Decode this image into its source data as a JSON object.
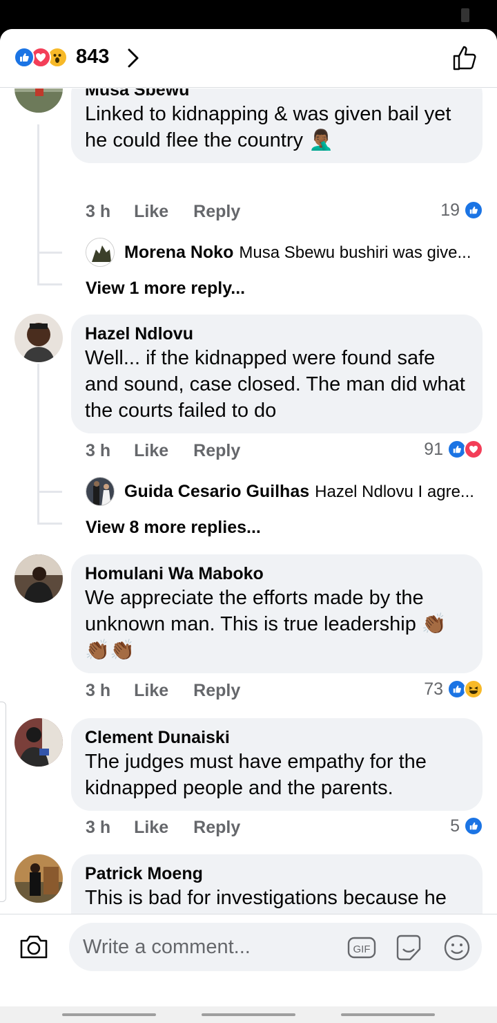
{
  "header": {
    "reaction_count": "843",
    "reaction_icons": [
      "like-icon",
      "love-icon",
      "wow-icon"
    ]
  },
  "comments": [
    {
      "name": "Musa Sbewu",
      "text": "Linked to kidnapping & was given bail yet he could flee the country 🤦🏾‍♂️",
      "time": "3 h",
      "like_label": "Like",
      "reply_label": "Reply",
      "reaction_count": "19",
      "reactions": [
        "like"
      ],
      "reply_preview": {
        "name": "Morena Noko",
        "text": "Musa Sbewu bushiri was give..."
      },
      "more_replies": "View 1 more reply..."
    },
    {
      "name": "Hazel Ndlovu",
      "text": "Well... if the kidnapped were found safe and sound, case closed. The man did what the courts failed to do",
      "time": "3 h",
      "like_label": "Like",
      "reply_label": "Reply",
      "reaction_count": "91",
      "reactions": [
        "like",
        "love"
      ],
      "reply_preview": {
        "name": "Guida Cesario Guilhas",
        "text": "Hazel Ndlovu I agre..."
      },
      "more_replies": "View 8 more replies..."
    },
    {
      "name": "Homulani Wa Maboko",
      "text": "We appreciate the efforts made by the unknown man. This is true leadership 👏🏾👏🏾👏🏾",
      "time": "3 h",
      "like_label": "Like",
      "reply_label": "Reply",
      "reaction_count": "73",
      "reactions": [
        "like",
        "haha"
      ]
    },
    {
      "name": "Clement Dunaiski",
      "text": "The judges must have empathy for the kidnapped people and the parents.",
      "time": "3 h",
      "like_label": "Like",
      "reply_label": "Reply",
      "reaction_count": "5",
      "reactions": [
        "like"
      ]
    },
    {
      "name": "Patrick Moeng",
      "text": "This is bad for investigations because he may have provided us with  leads. He has been killed by his own group so that"
    }
  ],
  "composer": {
    "placeholder": "Write a comment...",
    "gif_label": "GIF"
  },
  "colors": {
    "like_blue": "#1b74e4",
    "love_red": "#f33e58",
    "bubble_bg": "#f0f2f5",
    "meta_gray": "#65676b"
  }
}
